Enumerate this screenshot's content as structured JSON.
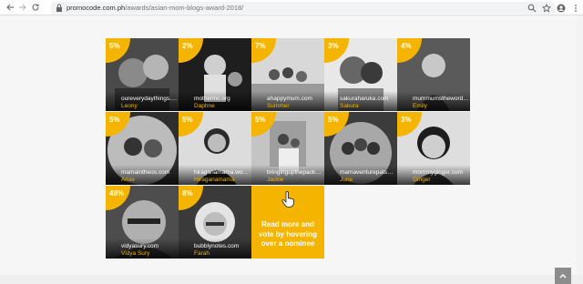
{
  "browser": {
    "url_domain": "promocode.com.ph",
    "url_path": "/awards/asian-mom-blogs-award-2018/"
  },
  "nominees": [
    {
      "percent": "5%",
      "site": "oureverydaythings.co...",
      "name": "Leony"
    },
    {
      "percent": "2%",
      "site": "motherinc.org",
      "name": "Daphne"
    },
    {
      "percent": "7%",
      "site": "ahappymum.com",
      "name": "Summer"
    },
    {
      "percent": "3%",
      "site": "sakuraharuka.com",
      "name": "Sakura"
    },
    {
      "percent": "4%",
      "site": "mummumstheword....",
      "name": "Emily"
    },
    {
      "percent": "5%",
      "site": "mamaintheos.com",
      "name": "Amie"
    },
    {
      "percent": "5%",
      "site": "hiraganamama.word...",
      "name": "Hiraganamama"
    },
    {
      "percent": "5%",
      "site": "bringingupthepacks.c...",
      "name": "Jackie"
    },
    {
      "percent": "5%",
      "site": "mamaventurepatshirt...",
      "name": "June"
    },
    {
      "percent": "3%",
      "site": "mommyginger.com",
      "name": "Ginger"
    },
    {
      "percent": "48%",
      "site": "vidyasury.com",
      "name": "Vidya Sury"
    },
    {
      "percent": "8%",
      "site": "bubblynotes.com",
      "name": "Farah"
    }
  ],
  "cta": {
    "text": "Read more and vote by hovering over a nominee"
  },
  "colors": {
    "accent": "#f5b400"
  },
  "icons": {
    "back": "back-arrow-icon",
    "forward": "forward-arrow-icon",
    "reload": "reload-icon",
    "lock": "lock-icon",
    "search": "search-icon",
    "star": "star-icon",
    "account": "account-icon",
    "menu": "kebab-menu-icon",
    "cursor": "hand-pointer-icon",
    "to_top": "chevron-up-icon"
  }
}
